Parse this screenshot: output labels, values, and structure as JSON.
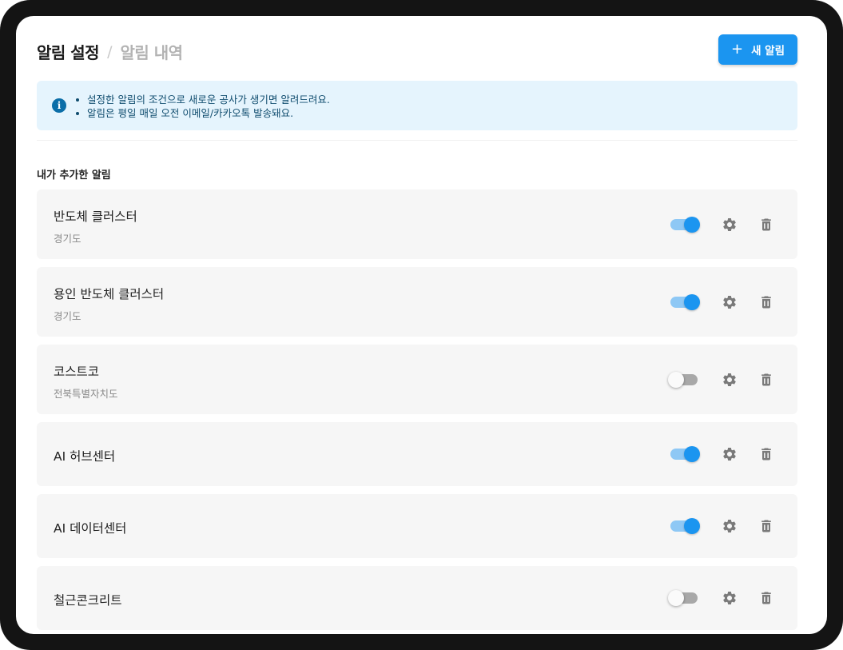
{
  "header": {
    "title": "알림 설정",
    "separator": "/",
    "history_tab": "알림 내역",
    "new_button_icon": "+",
    "new_button_label": "새 알림"
  },
  "info": {
    "icon": "info-icon",
    "lines": [
      "설정한 알림의 조건으로 새로운 공사가 생기면 알려드려요.",
      "알림은 평일 매일 오전 이메일/카카오톡 발송돼요."
    ]
  },
  "section_label": "내가 추가한 알림",
  "alerts": [
    {
      "name": "반도체 클러스터",
      "region": "경기도",
      "enabled": true
    },
    {
      "name": "용인 반도체 클러스터",
      "region": "경기도",
      "enabled": true
    },
    {
      "name": "코스트코",
      "region": "전북특별자치도",
      "enabled": false
    },
    {
      "name": "AI 허브센터",
      "region": "",
      "enabled": true
    },
    {
      "name": "AI 데이터센터",
      "region": "",
      "enabled": true
    },
    {
      "name": "철근콘크리트",
      "region": "",
      "enabled": false
    }
  ],
  "icons": {
    "settings": "gear-icon",
    "delete": "trash-icon"
  },
  "colors": {
    "accent": "#1b95f0",
    "info_bg": "#e5f4fd",
    "card_bg": "#f6f6f6"
  }
}
